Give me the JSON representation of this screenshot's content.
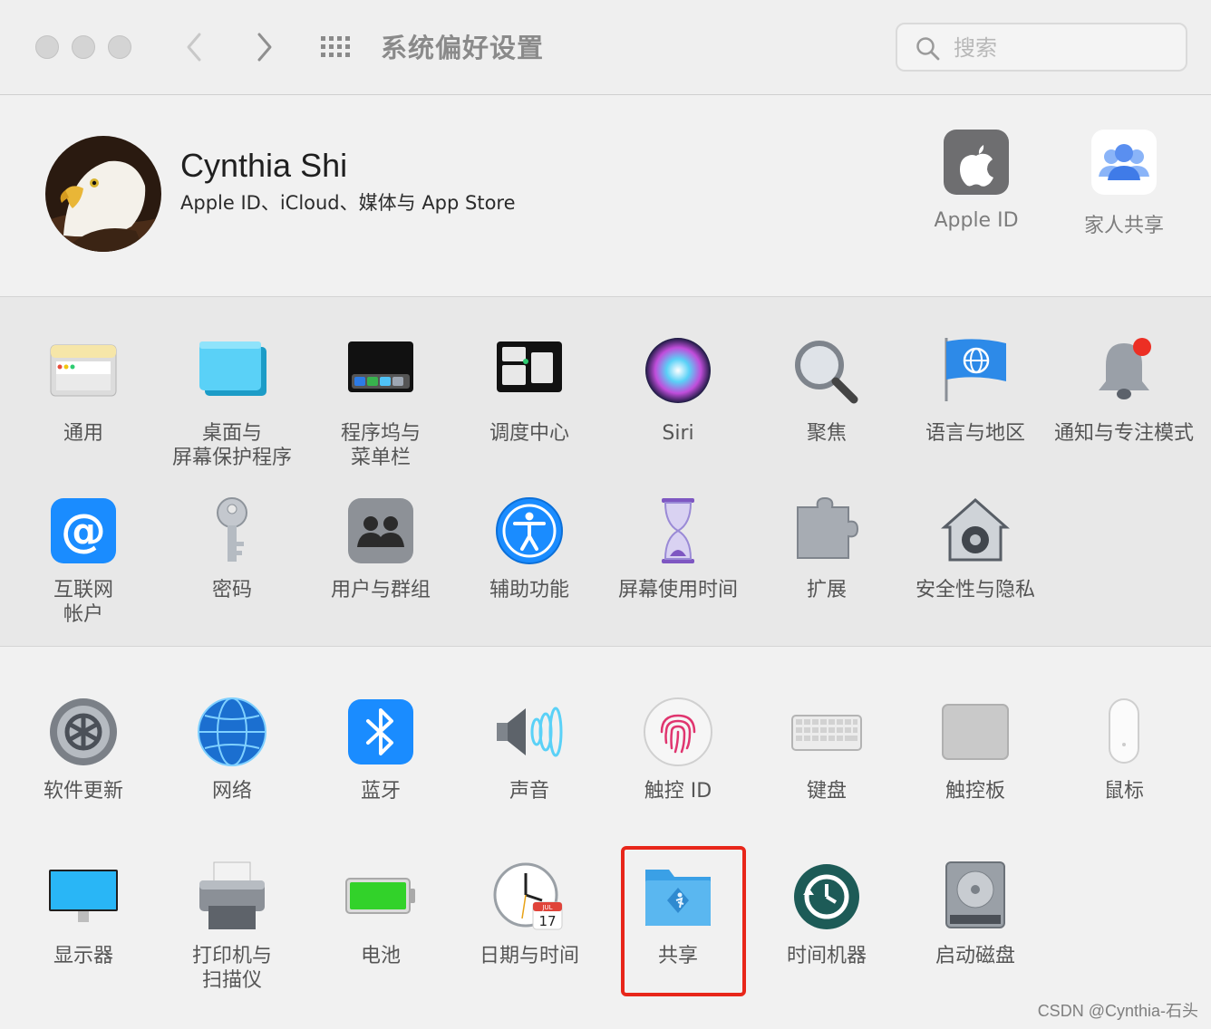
{
  "window": {
    "title": "系统偏好设置",
    "search_placeholder": "搜索"
  },
  "account": {
    "name": "Cynthia Shi",
    "subtitle": "Apple ID、iCloud、媒体与 App Store",
    "items": [
      {
        "label": "Apple ID",
        "icon": "apple-id-icon"
      },
      {
        "label": "家人共享",
        "icon": "family-sharing-icon"
      }
    ]
  },
  "section1": [
    {
      "label": "通用",
      "icon": "general-icon"
    },
    {
      "label": "桌面与\n屏幕保护程序",
      "icon": "desktop-screensaver-icon"
    },
    {
      "label": "程序坞与\n菜单栏",
      "icon": "dock-menubar-icon"
    },
    {
      "label": "调度中心",
      "icon": "mission-control-icon"
    },
    {
      "label": "Siri",
      "icon": "siri-icon"
    },
    {
      "label": "聚焦",
      "icon": "spotlight-icon"
    },
    {
      "label": "语言与地区",
      "icon": "language-region-icon"
    },
    {
      "label": "通知与专注模式",
      "icon": "notifications-icon"
    },
    {
      "label": "互联网\n帐户",
      "icon": "internet-accounts-icon"
    },
    {
      "label": "密码",
      "icon": "passwords-icon"
    },
    {
      "label": "用户与群组",
      "icon": "users-groups-icon"
    },
    {
      "label": "辅助功能",
      "icon": "accessibility-icon"
    },
    {
      "label": "屏幕使用时间",
      "icon": "screen-time-icon"
    },
    {
      "label": "扩展",
      "icon": "extensions-icon"
    },
    {
      "label": "安全性与隐私",
      "icon": "security-privacy-icon"
    }
  ],
  "section2": [
    {
      "label": "软件更新",
      "icon": "software-update-icon"
    },
    {
      "label": "网络",
      "icon": "network-icon"
    },
    {
      "label": "蓝牙",
      "icon": "bluetooth-icon"
    },
    {
      "label": "声音",
      "icon": "sound-icon"
    },
    {
      "label": "触控 ID",
      "icon": "touch-id-icon"
    },
    {
      "label": "键盘",
      "icon": "keyboard-icon"
    },
    {
      "label": "触控板",
      "icon": "trackpad-icon"
    },
    {
      "label": "鼠标",
      "icon": "mouse-icon"
    },
    {
      "label": "显示器",
      "icon": "displays-icon"
    },
    {
      "label": "打印机与\n扫描仪",
      "icon": "printers-scanners-icon"
    },
    {
      "label": "电池",
      "icon": "battery-icon"
    },
    {
      "label": "日期与时间",
      "icon": "date-time-icon"
    },
    {
      "label": "共享",
      "icon": "sharing-icon"
    },
    {
      "label": "时间机器",
      "icon": "time-machine-icon"
    },
    {
      "label": "启动磁盘",
      "icon": "startup-disk-icon"
    }
  ],
  "calendar": {
    "month": "JUL",
    "day": "17"
  },
  "watermark": "CSDN @Cynthia-石头",
  "colors": {
    "highlight": "#e8261a",
    "accent": "#1a8cff"
  }
}
